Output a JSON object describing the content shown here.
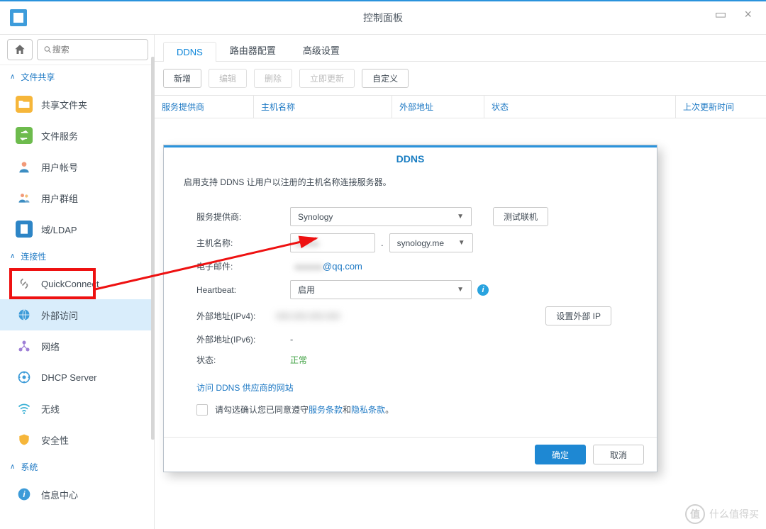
{
  "window": {
    "title": "控制面板"
  },
  "search": {
    "placeholder": "搜索"
  },
  "sidebar": {
    "sections": {
      "fileshare": {
        "label": "文件共享"
      },
      "connectivity": {
        "label": "连接性"
      },
      "system": {
        "label": "系统"
      }
    },
    "items": {
      "shared_folder": "共享文件夹",
      "file_service": "文件服务",
      "user": "用户帐号",
      "group": "用户群组",
      "domain": "域/LDAP",
      "quickconnect": "QuickConnect",
      "external_access": "外部访问",
      "network": "网络",
      "dhcp": "DHCP Server",
      "wireless": "无线",
      "security": "安全性",
      "info_center": "信息中心"
    }
  },
  "tabs": {
    "ddns": "DDNS",
    "router": "路由器配置",
    "advanced": "高级设置"
  },
  "toolbar": {
    "add": "新增",
    "edit": "编辑",
    "delete": "删除",
    "update_now": "立即更新",
    "custom": "自定义"
  },
  "table": {
    "col_provider": "服务提供商",
    "col_hostname": "主机名称",
    "col_ext_addr": "外部地址",
    "col_status": "状态",
    "col_last_update": "上次更新时间"
  },
  "dialog": {
    "title": "DDNS",
    "desc": "启用支持 DDNS 让用户以注册的主机名称连接服务器。",
    "labels": {
      "provider": "服务提供商:",
      "hostname": "主机名称:",
      "email": "电子邮件:",
      "heartbeat": "Heartbeat:",
      "ext_ipv4": "外部地址(IPv4):",
      "ext_ipv6": "外部地址(IPv6):",
      "status": "状态:"
    },
    "values": {
      "provider": "Synology",
      "domain_suffix": "synology.me",
      "email_suffix": "@qq.com",
      "heartbeat": "启用",
      "ext_ipv6": "-",
      "status": "正常"
    },
    "buttons": {
      "test": "测试联机",
      "set_ext_ip": "设置外部 IP",
      "ok": "确定",
      "cancel": "取消"
    },
    "link_text": "访问 DDNS 供应商的网站",
    "agree": {
      "prefix": "请勾选确认您已同意遵守",
      "tos": "服务条款",
      "and": "和",
      "privacy": "隐私条款",
      "suffix": "。"
    },
    "dot": "."
  },
  "watermark": {
    "symbol": "值",
    "text": "什么值得买"
  }
}
